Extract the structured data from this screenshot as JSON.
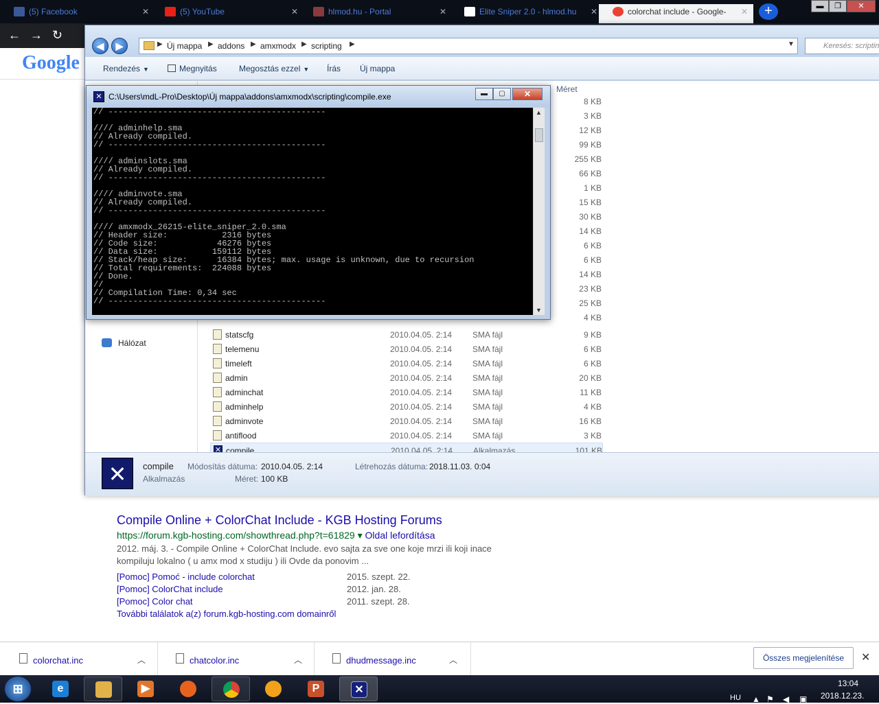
{
  "chrome": {
    "tabs": [
      {
        "label": "(5) Facebook",
        "favicon": "facebook-icon",
        "color": "#3b5998"
      },
      {
        "label": "(5) YouTube",
        "favicon": "youtube-icon",
        "color": "#e62117"
      },
      {
        "label": "hlmod.hu - Portal",
        "favicon": "hlmod-icon",
        "color": "#8a3a3a"
      },
      {
        "label": "Elite Sniper 2.0 - hlmod.hu",
        "favicon": "page-icon",
        "color": "#ffffff"
      },
      {
        "label": "colorchat include - Google-",
        "favicon": "google-icon",
        "color": "#ea4335"
      }
    ],
    "new_tab": "+",
    "logo": "Google"
  },
  "explorer": {
    "breadcrumbs": [
      "Új mappa",
      "addons",
      "amxmodx",
      "scripting"
    ],
    "search_placeholder": "Keresés: scripting",
    "toolbar": {
      "organize": "Rendezés",
      "open": "Megnyitás",
      "share": "Megosztás ezzel",
      "burn": "Írás",
      "new_folder": "Új mappa"
    },
    "size_header": "Méret",
    "nav_network": "Hálózat",
    "upper_sizes": [
      "8 KB",
      "3 KB",
      "12 KB",
      "99 KB",
      "255 KB",
      "66 KB",
      "1 KB",
      "15 KB",
      "30 KB",
      "14 KB",
      "6 KB",
      "6 KB",
      "14 KB",
      "23 KB",
      "25 KB",
      "4 KB"
    ],
    "files": [
      {
        "name": "statscfg",
        "date": "2010.04.05. 2:14",
        "type": "SMA fájl",
        "size": "9 KB"
      },
      {
        "name": "telemenu",
        "date": "2010.04.05. 2:14",
        "type": "SMA fájl",
        "size": "6 KB"
      },
      {
        "name": "timeleft",
        "date": "2010.04.05. 2:14",
        "type": "SMA fájl",
        "size": "6 KB"
      },
      {
        "name": "admin",
        "date": "2010.04.05. 2:14",
        "type": "SMA fájl",
        "size": "20 KB"
      },
      {
        "name": "adminchat",
        "date": "2010.04.05. 2:14",
        "type": "SMA fájl",
        "size": "11 KB"
      },
      {
        "name": "adminhelp",
        "date": "2010.04.05. 2:14",
        "type": "SMA fájl",
        "size": "4 KB"
      },
      {
        "name": "adminvote",
        "date": "2010.04.05. 2:14",
        "type": "SMA fájl",
        "size": "16 KB"
      },
      {
        "name": "antiflood",
        "date": "2010.04.05. 2:14",
        "type": "SMA fájl",
        "size": "3 KB"
      },
      {
        "name": "compile",
        "date": "2010.04.05. 2:14",
        "type": "Alkalmazás",
        "size": "101 KB"
      }
    ],
    "details": {
      "name": "compile",
      "kind": "Alkalmazás",
      "modified_label": "Módosítás dátuma:",
      "modified_value": "2010.04.05. 2:14",
      "created_label": "Létrehozás dátuma:",
      "created_value": "2018.11.03. 0:04",
      "size_label": "Méret:",
      "size_value": "100 KB"
    }
  },
  "console": {
    "title": "C:\\Users\\mdL-Pro\\Desktop\\Új mappa\\addons\\amxmodx\\scripting\\compile.exe",
    "minimize": "▬",
    "maximize": "▢",
    "close": "✕",
    "text": "// --------------------------------------------\n\n//// adminhelp.sma\n// Already compiled.\n// --------------------------------------------\n\n//// adminslots.sma\n// Already compiled.\n// --------------------------------------------\n\n//// adminvote.sma\n// Already compiled.\n// --------------------------------------------\n\n//// amxmodx_26215-elite_sniper_2.0.sma\n// Header size:           2316 bytes\n// Code size:            46276 bytes\n// Data size:           159112 bytes\n// Stack/heap size:      16384 bytes; max. usage is unknown, due to recursion\n// Total requirements:  224088 bytes\n// Done.\n//\n// Compilation Time: 0,34 sec\n// --------------------------------------------"
  },
  "results": {
    "title": "Compile Online + ColorChat Include - KGB Hosting Forums",
    "url": "https://forum.kgb-hosting.com/showthread.php?t=61829",
    "translate": "Oldal lefordítása",
    "snippet_line1": "2012. máj. 3. - Compile Online + ColorChat Include. evo sajta za sve one koje mrzi ili koji inace",
    "snippet_line2": "kompiluju lokalno ( u amx mod x studiju ) ili Ovde da ponovim ...",
    "sublinks": [
      {
        "label": "[Pomoc] Pomoć - include colorchat",
        "date": "2015. szept. 22."
      },
      {
        "label": "[Pomoc] ColorChat include",
        "date": "2012. jan. 28."
      },
      {
        "label": "[Pomoc] Color chat",
        "date": "2011. szept. 28."
      }
    ],
    "more": "További találatok a(z) forum.kgb-hosting.com domainről"
  },
  "downloads": {
    "items": [
      "colorchat.inc",
      "chatcolor.inc",
      "dhudmessage.inc"
    ],
    "show_all": "Összes megjelenítése",
    "close": "✕"
  },
  "taskbar": {
    "language": "HU",
    "time": "13:04",
    "date": "2018.12.23."
  }
}
